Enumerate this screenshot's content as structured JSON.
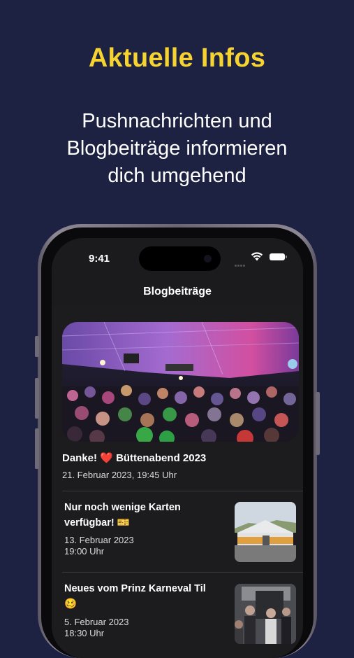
{
  "promo": {
    "headline": "Aktuelle Infos",
    "subline_line1": "Pushnachrichten und",
    "subline_line2": "Blogbeiträge informieren",
    "subline_line3": "dich umgehend"
  },
  "status_bar": {
    "time": "9:41"
  },
  "nav": {
    "title": "Blogbeiträge"
  },
  "featured_post": {
    "title_prefix": "Danke!",
    "title_emoji": "❤️",
    "title_suffix": "Büttenabend 2023",
    "date": "21. Februar 2023, 19:45 Uhr"
  },
  "posts": [
    {
      "title_line1": "Nur noch wenige Karten",
      "title_line2": "verfügbar! 🎫",
      "date_line1": "13. Februar 2023",
      "date_line2": "19:00 Uhr"
    },
    {
      "title_line1": "Neues vom Prinz Karneval Til",
      "title_line2": "🥴",
      "date_line1": "5. Februar 2023",
      "date_line2": "18:30 Uhr"
    }
  ],
  "colors": {
    "background": "#1d2142",
    "headline": "#f5d330",
    "screen": "#1c1c1e"
  }
}
